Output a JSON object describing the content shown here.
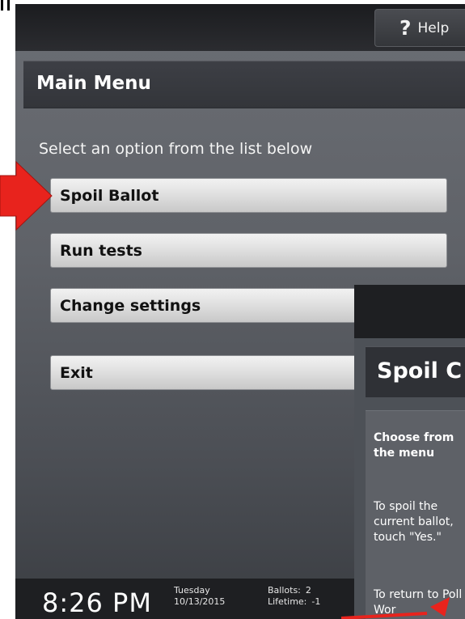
{
  "help": {
    "icon": "question-mark-icon",
    "label": "Help"
  },
  "header": {
    "title": "Main Menu"
  },
  "instructions": "Select an option from the list below",
  "menu": [
    {
      "label": "Spoil Ballot"
    },
    {
      "label": "Run tests"
    },
    {
      "label": "Change settings"
    },
    {
      "label": "Exit"
    }
  ],
  "status": {
    "time": "8:26 PM",
    "day": "Tuesday",
    "date": "10/13/2015",
    "ballots_label": "Ballots:",
    "ballots_value": "2",
    "lifetime_label": "Lifetime:",
    "lifetime_value": "-1"
  },
  "overlay": {
    "title": "Spoil C",
    "heading": "Choose from the menu",
    "para1": "To spoil the current ballot, touch \"Yes.\"",
    "para2": "To return to Poll Wor"
  },
  "annotation_color": "#e8231d"
}
